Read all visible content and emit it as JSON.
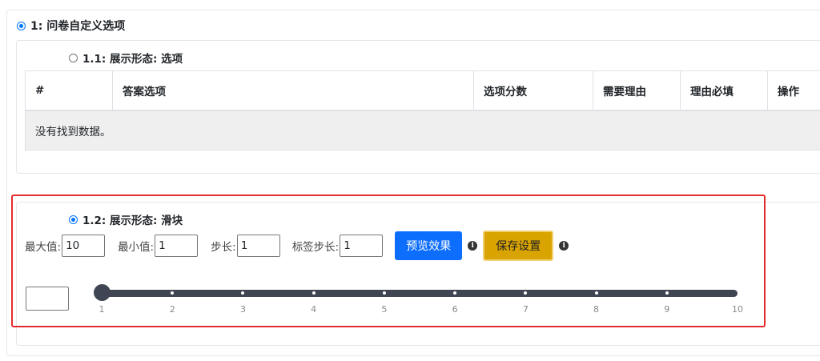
{
  "section": {
    "title": "1: 问卷自定义选项"
  },
  "options_view": {
    "title": "1.1: 展示形态: 选项",
    "columns": [
      "#",
      "答案选项",
      "选项分数",
      "需要理由",
      "理由必填",
      "操作"
    ],
    "empty_text": "没有找到数据。"
  },
  "slider_view": {
    "title": "1.2: 展示形态: 滑块",
    "max_label": "最大值:",
    "max_value": "10",
    "min_label": "最小值:",
    "min_value": "1",
    "step_label": "步长:",
    "step_value": "1",
    "tick_step_label": "标签步长:",
    "tick_step_value": "1",
    "preview_button": "预览效果",
    "save_button": "保存设置",
    "info_icon": "i",
    "current_value": "",
    "slider_value": 1,
    "ticks": [
      "1",
      "2",
      "3",
      "4",
      "5",
      "6",
      "7",
      "8",
      "9",
      "10"
    ]
  },
  "colors": {
    "primary": "#0d6efd",
    "warning": "#d9a400",
    "highlight": "#e52c2c",
    "track": "#3f4552"
  }
}
